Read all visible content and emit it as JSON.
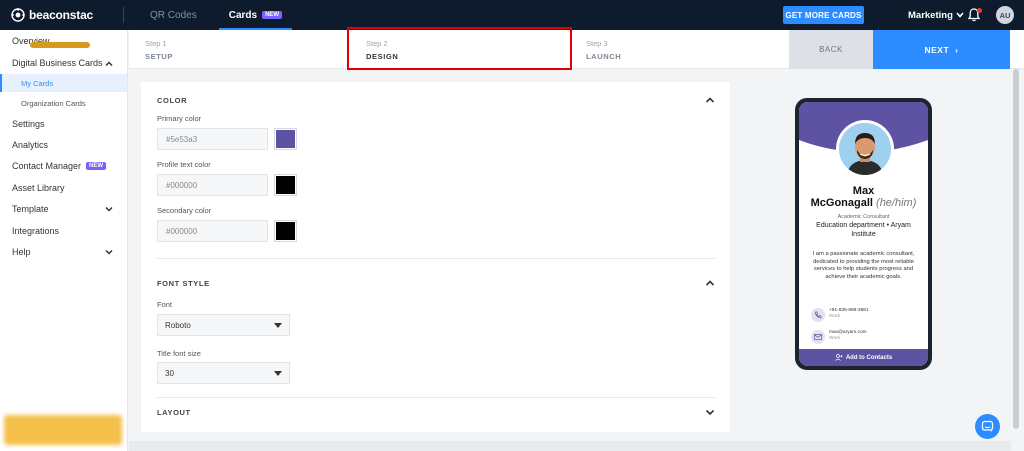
{
  "topbar": {
    "logo": "beaconstac",
    "tabs": [
      {
        "label": "QR Codes",
        "active": false
      },
      {
        "label": "Cards",
        "active": true,
        "badge": "NEW"
      }
    ],
    "get_more_button": "GET MORE CARDS",
    "org_name": "Marketing",
    "avatar_initials": "AU"
  },
  "sidebar": {
    "items": [
      {
        "label": "Overview"
      },
      {
        "label": "Digital Business Cards",
        "expanded": true
      },
      {
        "label": "My Cards",
        "sub": true,
        "active": true
      },
      {
        "label": "Organization Cards",
        "sub": true
      },
      {
        "label": "Settings"
      },
      {
        "label": "Analytics"
      },
      {
        "label": "Contact Manager",
        "badge": "NEW"
      },
      {
        "label": "Asset Library"
      },
      {
        "label": "Template",
        "expandable": true
      },
      {
        "label": "Integrations"
      },
      {
        "label": "Help",
        "expandable": true
      }
    ]
  },
  "stepper": {
    "steps": [
      {
        "num": "Step 1",
        "name": "SETUP"
      },
      {
        "num": "Step 2",
        "name": "DESIGN",
        "active": true
      },
      {
        "num": "Step 3",
        "name": "LAUNCH"
      }
    ],
    "back_label": "BACK",
    "next_label": "NEXT",
    "next_arrow": "›"
  },
  "form": {
    "color_section": {
      "title": "COLOR",
      "primary_label": "Primary color",
      "primary_value": "#5e53a3",
      "profile_text_label": "Profile text color",
      "profile_text_value": "#000000",
      "secondary_label": "Secondary color",
      "secondary_value": "#000000"
    },
    "font_section": {
      "title": "FONT STYLE",
      "font_label": "Font",
      "font_value": "Roboto",
      "size_label": "Title font size",
      "size_value": "30"
    },
    "layout_section": {
      "title": "LAYOUT"
    }
  },
  "preview": {
    "first_name": "Max",
    "last_name": "McGonagall",
    "pronoun": "(he/him)",
    "title": "Academic Consultant",
    "dept_line1": "Education department • Aryam",
    "dept_line2": "Institute",
    "bio": "I am a passionate academic consultant, dedicated to providing the most reliable services to help students progress and achieve their academic goals.",
    "phone": "+91-635-688-3881",
    "phone_sub": "Work",
    "email": "max@aryam.com",
    "email_sub": "Work",
    "add_contacts": "Add to Contacts"
  },
  "colors": {
    "accent": "#2d8cff",
    "primary": "#5e53a3",
    "profile_text": "#000000",
    "secondary": "#000000",
    "topbar_bg": "#0e1b2c",
    "highlight": "#e10000"
  },
  "icons": {
    "logo": "beaconstac-logo-icon",
    "org_dropdown": "chevron-down-icon",
    "notifications": "bell-icon",
    "chat": "chat-icon",
    "phone": "phone-icon",
    "email": "mail-icon",
    "add_contact": "person-add-icon"
  }
}
